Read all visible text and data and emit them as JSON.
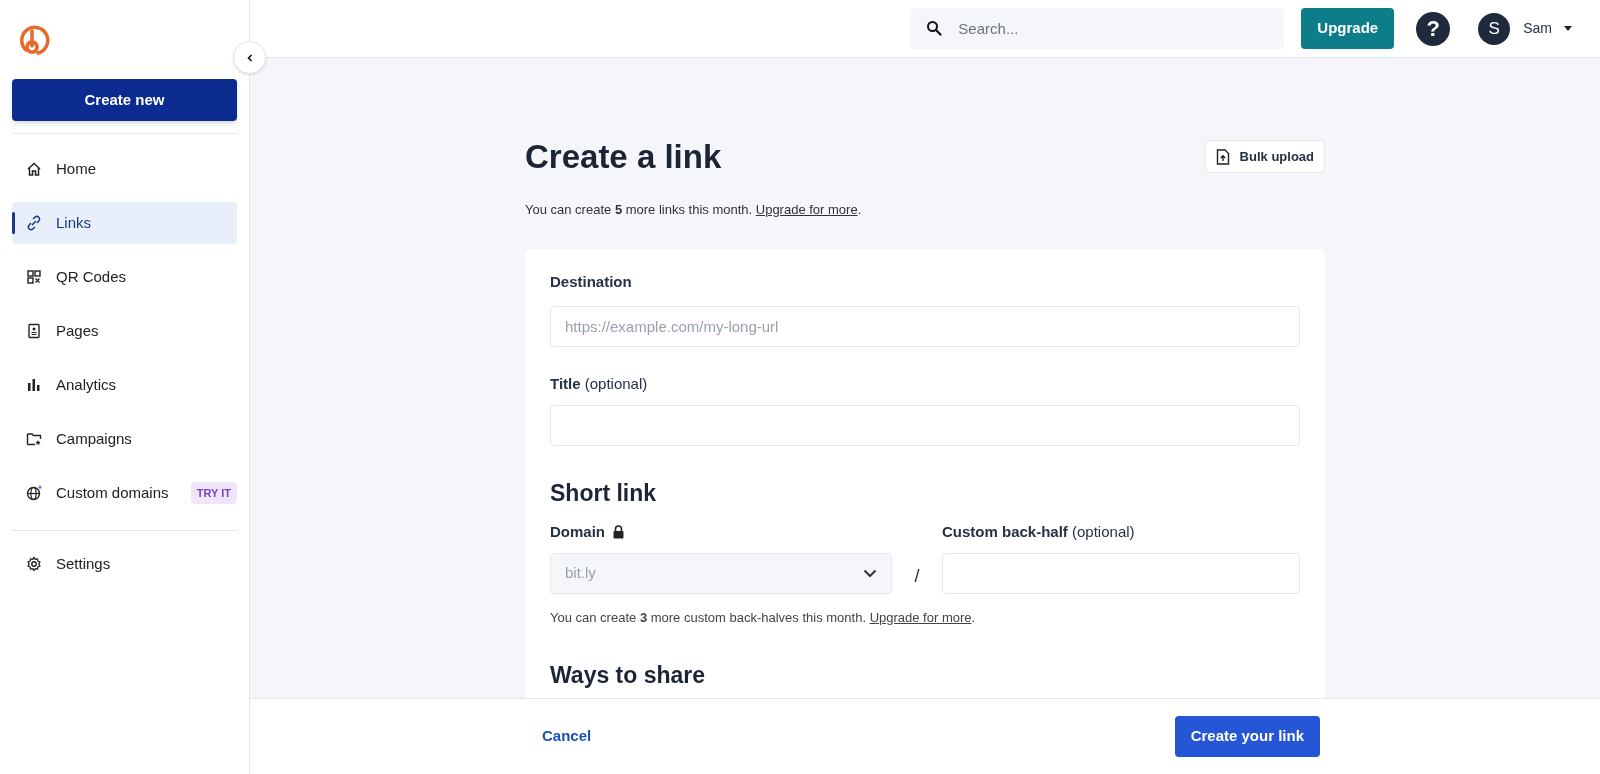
{
  "sidebar": {
    "create_button": "Create new",
    "items": [
      {
        "label": "Home",
        "selected": false
      },
      {
        "label": "Links",
        "selected": true
      },
      {
        "label": "QR Codes",
        "selected": false
      },
      {
        "label": "Pages",
        "selected": false
      },
      {
        "label": "Analytics",
        "selected": false
      },
      {
        "label": "Campaigns",
        "selected": false
      },
      {
        "label": "Custom domains",
        "selected": false,
        "badge": "TRY IT"
      }
    ],
    "footer_items": [
      {
        "label": "Settings",
        "selected": false
      }
    ]
  },
  "topbar": {
    "search": {
      "placeholder": "Search..."
    },
    "upgrade_button": "Upgrade",
    "help": "?",
    "avatar": "S",
    "user": "Sam"
  },
  "page": {
    "title": "Create a link",
    "bulk_button": "Bulk upload",
    "notice": {
      "text": "You can create **5** more links this month.",
      "link": "Upgrade for more",
      "after": "."
    },
    "destination": {
      "label": "Destination",
      "placeholder": "https://example.com/my-long-url"
    },
    "title_field": {
      "label": "**Title** (optional)"
    },
    "short_link": {
      "heading": "Short link",
      "domain_label": "Domain",
      "domain_value": "bit.ly",
      "separator": "/",
      "back_half_label": "**Custom back-half** (optional)",
      "notice": {
        "text": "You can create **3** more custom back-halves this month.",
        "link": "Upgrade for more",
        "after": "."
      }
    },
    "next_heading": "Ways to share"
  },
  "footer": {
    "cancel": "Cancel",
    "submit": "Create your link"
  }
}
